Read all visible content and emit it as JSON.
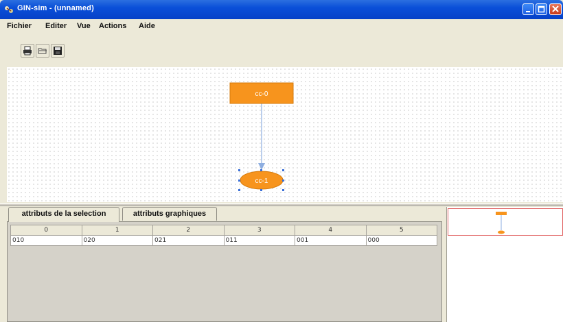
{
  "window": {
    "title": "GIN-sim -  (unnamed)"
  },
  "menubar": {
    "items": [
      "Fichier",
      "Editer",
      "Vue",
      "Actions",
      "Aide"
    ]
  },
  "toolbar": {
    "icons": [
      "print-icon",
      "open-folder-icon",
      "save-disk-icon"
    ]
  },
  "graph": {
    "nodes": [
      {
        "id": "cc-0",
        "label": "cc-0",
        "shape": "rectangle",
        "color": "#f7941d"
      },
      {
        "id": "cc-1",
        "label": "cc-1",
        "shape": "ellipse",
        "color": "#f7941d"
      }
    ],
    "edge_color": "#8eaee0"
  },
  "tabs": [
    {
      "label": "attributs de la selection",
      "active": true
    },
    {
      "label": "attributs graphiques",
      "active": false
    }
  ],
  "table": {
    "headers": [
      "0",
      "1",
      "2",
      "3",
      "4",
      "5"
    ],
    "rows": [
      [
        "010",
        "020",
        "021",
        "011",
        "001",
        "000"
      ]
    ]
  },
  "colors": {
    "title_bar": "#0a4fd8",
    "node_fill": "#f7941d",
    "overview_frame": "#e06060"
  }
}
